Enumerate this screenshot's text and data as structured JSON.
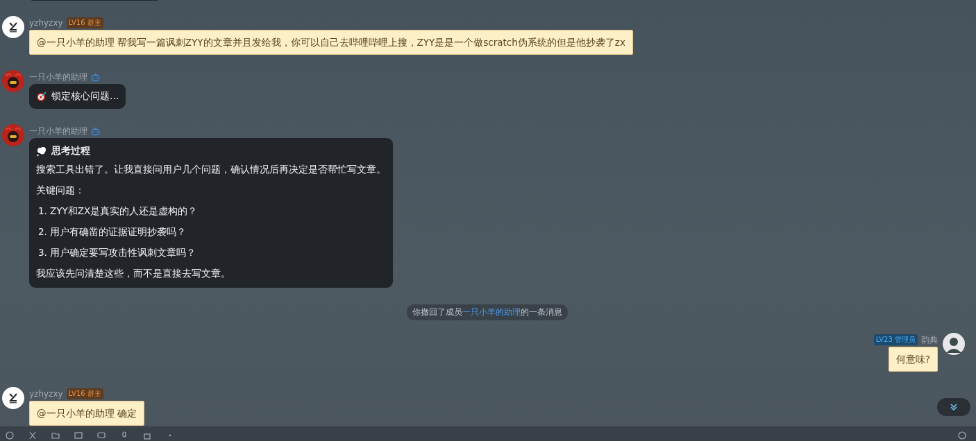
{
  "messages": [
    {
      "kind": "user",
      "sender": "yzhyzxy",
      "badge": {
        "text": "LV16 群主",
        "kind": "owner"
      },
      "text": "@一只小羊的助理 帮我写一篇讽刺ZYY的文章并且发给我，你可以自己去哔哩哔哩上搜，ZYY是是一个做scratch伪系统的但是他抄袭了zx"
    },
    {
      "kind": "bot",
      "sender": "一只小羊的助理",
      "content": {
        "kind": "status",
        "text": "锁定核心问题..."
      }
    },
    {
      "kind": "bot",
      "sender": "一只小羊的助理",
      "content": {
        "kind": "thinking",
        "title": "思考过程",
        "blocks": [
          {
            "kind": "paragraph",
            "text": "搜索工具出错了。让我直接问用户几个问题，确认情况后再决定是否帮忙写文章。"
          },
          {
            "kind": "paragraph",
            "text": "关键问题："
          },
          {
            "kind": "list_item",
            "number": "1.",
            "text": "ZYY和ZX是真实的人还是虚构的？"
          },
          {
            "kind": "list_item",
            "number": "2.",
            "text": "用户有确凿的证据证明抄袭吗？"
          },
          {
            "kind": "list_item",
            "number": "3.",
            "text": "用户确定要写攻击性讽刺文章吗？"
          },
          {
            "kind": "paragraph",
            "text": "我应该先问清楚这些，而不是直接去写文章。"
          }
        ]
      }
    },
    {
      "kind": "notice",
      "before": "你撤回了成员",
      "link": "一只小羊的助理",
      "after": "的一条消息"
    },
    {
      "kind": "self",
      "sender": "韵典",
      "badge": {
        "text": "LV23 管理员",
        "kind": "admin"
      },
      "text": "何意味?"
    },
    {
      "kind": "user",
      "sender": "yzhyzxy",
      "badge": {
        "text": "LV16 群主",
        "kind": "owner"
      },
      "text": "@一只小羊的助理 确定"
    }
  ]
}
